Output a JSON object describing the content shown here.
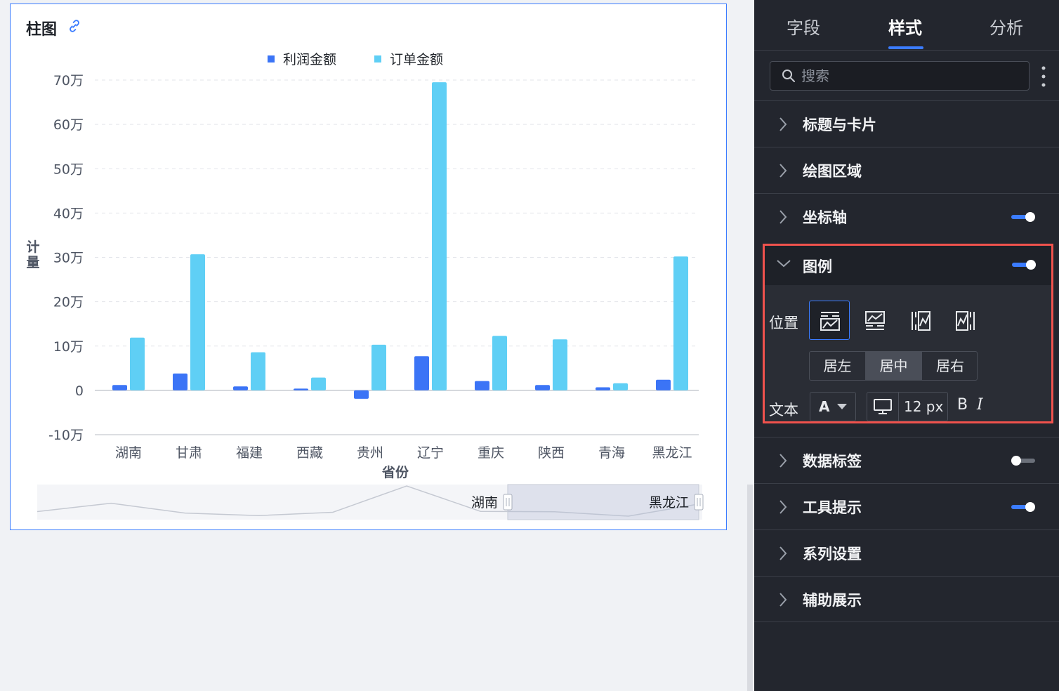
{
  "card": {
    "title": "柱图"
  },
  "chart_data": {
    "type": "bar",
    "categories": [
      "湖南",
      "甘肃",
      "福建",
      "西藏",
      "贵州",
      "辽宁",
      "重庆",
      "陕西",
      "青海",
      "黑龙江"
    ],
    "series": [
      {
        "name": "利润金额",
        "color": "#3b74f6",
        "values": [
          12000,
          38000,
          9000,
          4000,
          -19000,
          77000,
          21000,
          12000,
          7000,
          24000
        ]
      },
      {
        "name": "订单金额",
        "color": "#5fcff5",
        "values": [
          119000,
          307000,
          86000,
          29000,
          103000,
          695000,
          123000,
          115000,
          16000,
          302000
        ]
      }
    ],
    "xlabel": "省份",
    "ylabel": "计量",
    "ylim": [
      -100000,
      700000
    ],
    "yticks": [
      {
        "value": 700000,
        "label": "70万"
      },
      {
        "value": 600000,
        "label": "60万"
      },
      {
        "value": 500000,
        "label": "50万"
      },
      {
        "value": 400000,
        "label": "40万"
      },
      {
        "value": 300000,
        "label": "30万"
      },
      {
        "value": 200000,
        "label": "20万"
      },
      {
        "value": 100000,
        "label": "10万"
      },
      {
        "value": 0,
        "label": "0"
      },
      {
        "value": -100000,
        "label": "-10万"
      }
    ],
    "grid": true,
    "legend_position": "top-center",
    "zoom_slider": {
      "start_label": "湖南",
      "end_label": "黑龙江"
    }
  },
  "panel": {
    "tabs": [
      {
        "label": "字段",
        "active": false
      },
      {
        "label": "样式",
        "active": true
      },
      {
        "label": "分析",
        "active": false
      }
    ],
    "search": {
      "placeholder": "搜索"
    },
    "sections_top": [
      {
        "label": "标题与卡片",
        "toggle": null
      },
      {
        "label": "绘图区域",
        "toggle": null
      },
      {
        "label": "坐标轴",
        "toggle": "on"
      }
    ],
    "legend": {
      "label": "图例",
      "toggle": "on",
      "position_label": "位置",
      "positions": [
        "top",
        "bottom",
        "left",
        "right"
      ],
      "selected_position": "top",
      "align_options": [
        "居左",
        "居中",
        "居右"
      ],
      "selected_align": "居中",
      "text_label": "文本",
      "font_color_letter": "A",
      "font_size": "12 px",
      "bold_label": "B",
      "italic_label": "I"
    },
    "sections_bottom": [
      {
        "label": "数据标签",
        "toggle": "off"
      },
      {
        "label": "工具提示",
        "toggle": "on"
      },
      {
        "label": "系列设置",
        "toggle": null
      },
      {
        "label": "辅助展示",
        "toggle": null
      }
    ]
  },
  "colors": {
    "accent": "#3b7cff",
    "highlight_border": "#f0524d",
    "panel_bg": "#23262e"
  }
}
